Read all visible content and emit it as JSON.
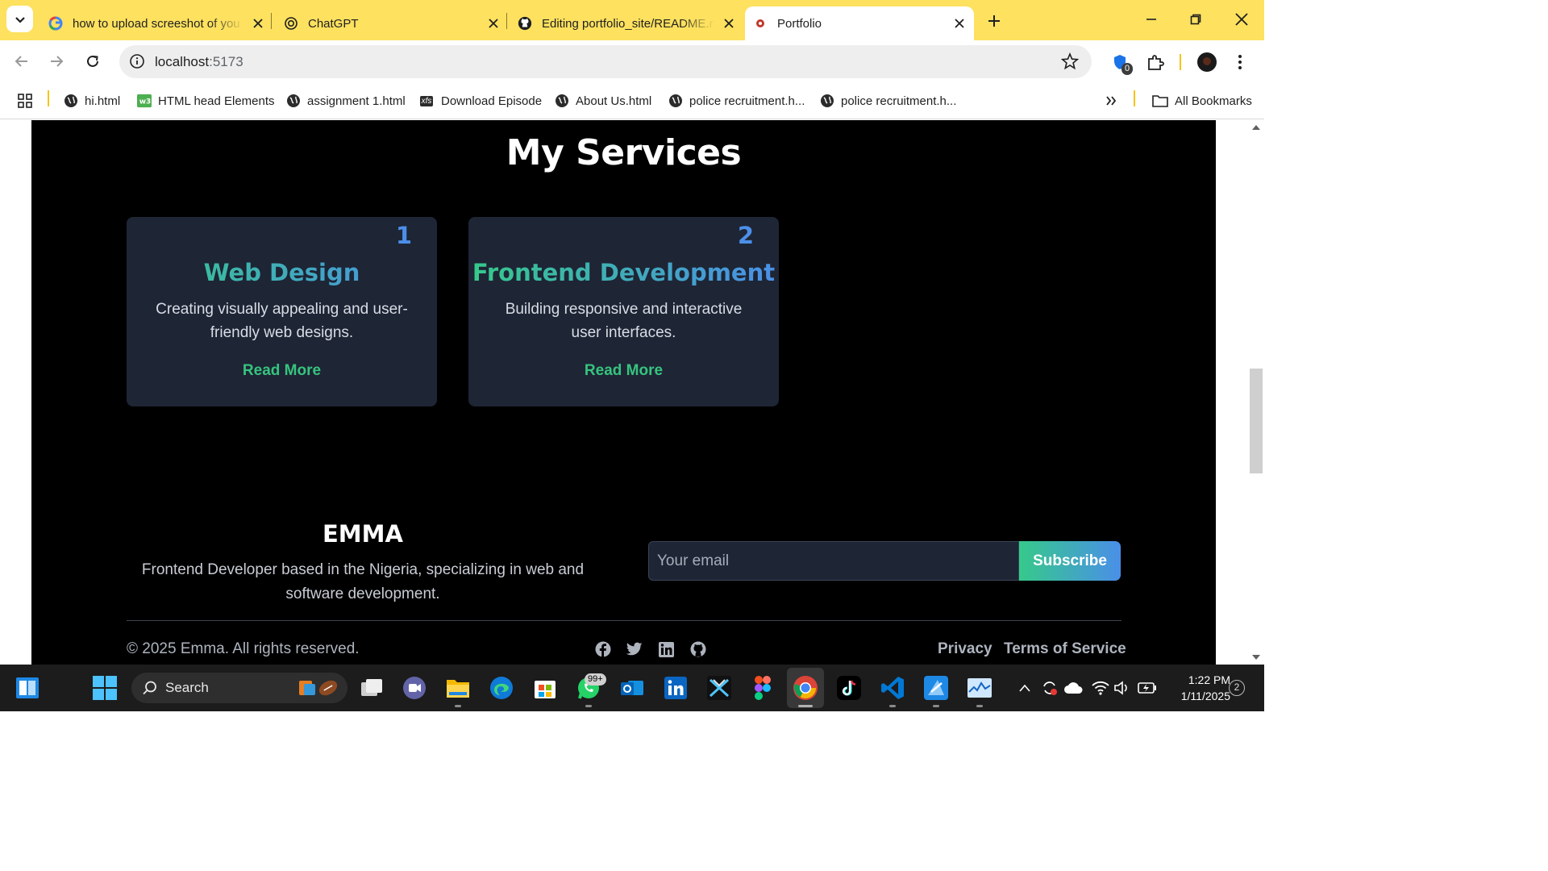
{
  "browser": {
    "tabs": [
      {
        "title": "how to upload screeshot of you",
        "active": false
      },
      {
        "title": "ChatGPT",
        "active": false
      },
      {
        "title": "Editing portfolio_site/README.r",
        "active": false
      },
      {
        "title": "Portfolio",
        "active": true
      }
    ],
    "address": {
      "host": "localhost",
      "port": ":5173"
    },
    "extension_badge": "0",
    "bookmarks": [
      "hi.html",
      "HTML head Elements",
      "assignment 1.html",
      "Download Episode",
      "About Us.html",
      "police recruitment.h...",
      "police recruitment.h..."
    ],
    "bookmark_badge_xfs": "xfs",
    "all_bookmarks": "All Bookmarks",
    "colors": {
      "tabstrip": "#fde15f",
      "accent_divider": "#f5c518"
    }
  },
  "page": {
    "services_title": "My Services",
    "services": [
      {
        "number": "1",
        "title": "Web Design",
        "desc_line1": "Creating visually appealing and user-",
        "desc_line2": "friendly web designs.",
        "link": "Read More"
      },
      {
        "number": "2",
        "title": "Frontend Development",
        "desc_line1": "Building responsive and interactive",
        "desc_line2": "user interfaces.",
        "link": "Read More"
      }
    ],
    "footer": {
      "brand": "EMMA",
      "tagline_line1": "Frontend Developer based in the Nigeria, specializing in web and",
      "tagline_line2": "software development.",
      "email_placeholder": "Your email",
      "subscribe": "Subscribe",
      "copyright": "© 2025 Emma. All rights reserved.",
      "socials": [
        "facebook-icon",
        "twitter-icon",
        "linkedin-icon",
        "github-icon"
      ],
      "links": [
        "Privacy",
        "Terms of Service"
      ]
    },
    "colors": {
      "bg": "#000000",
      "card": "#1e2535",
      "number": "#4c8fe8",
      "gradient_start": "#36c98a",
      "gradient_end": "#4a8fe8",
      "link": "#36c47e"
    }
  },
  "taskbar": {
    "search_label": "Search",
    "whatsapp_badge": "99+",
    "time": "1:22 PM",
    "date": "1/11/2025",
    "notification_count": "2"
  }
}
